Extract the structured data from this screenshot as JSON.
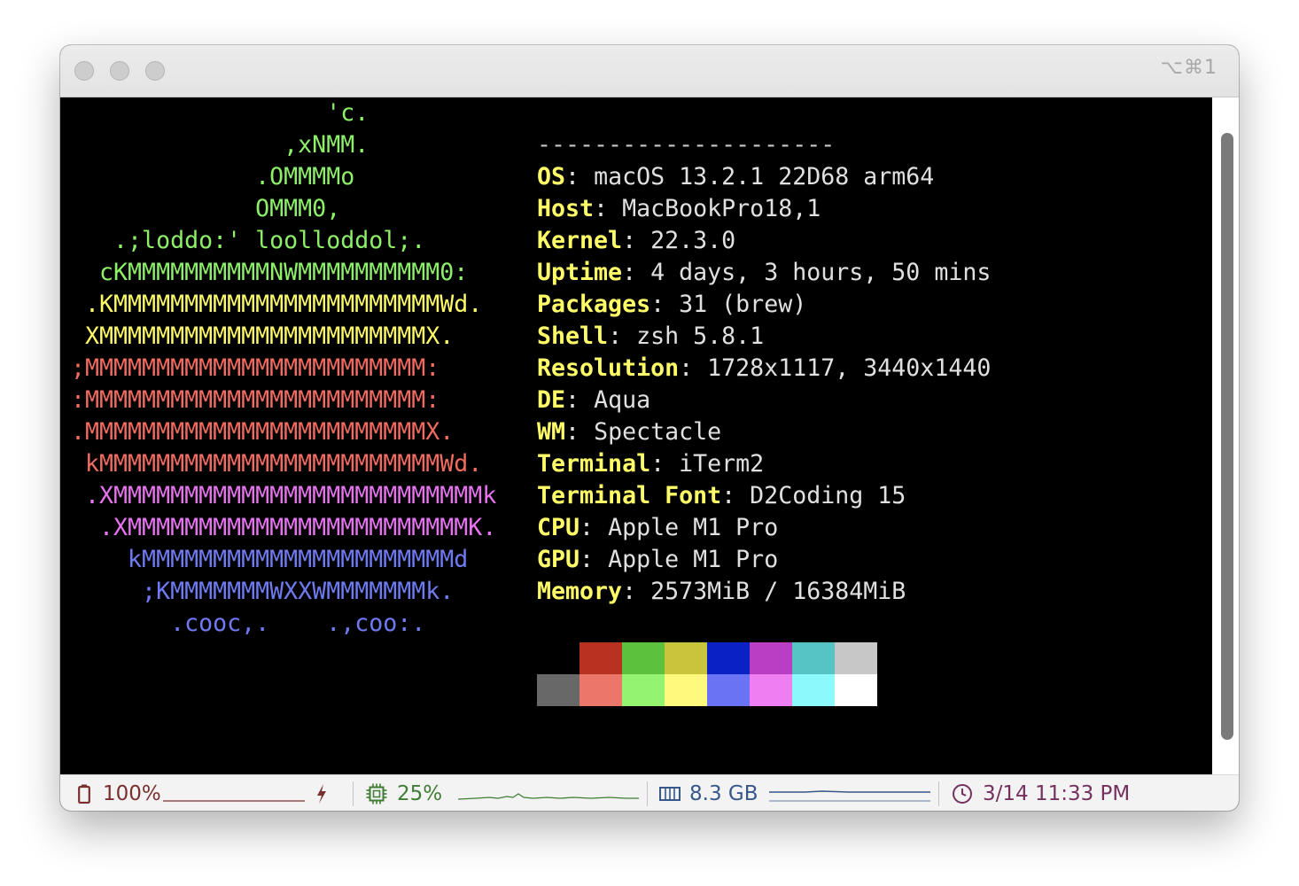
{
  "titlebar": {
    "shortcut": "⌥⌘1"
  },
  "ascii_logo": [
    {
      "text": "                  'c.",
      "color": "#8ef068"
    },
    {
      "text": "               ,xNMM.",
      "color": "#8ef068"
    },
    {
      "text": "             .OMMMMo",
      "color": "#8ef068"
    },
    {
      "text": "             OMMM0,",
      "color": "#8ef068"
    },
    {
      "text": "   .;loddo:' loolloddol;.",
      "color": "#8ef068"
    },
    {
      "text": "  cKMMMMMMMMMMNWMMMMMMMMMM0:",
      "color": "#8ef068"
    },
    {
      "text": " .KMMMMMMMMMMMMMMMMMMMMMMMWd.",
      "color": "#fffc67"
    },
    {
      "text": " XMMMMMMMMMMMMMMMMMMMMMMMX.",
      "color": "#fffc67"
    },
    {
      "text": ";MMMMMMMMMMMMMMMMMMMMMMMM:",
      "color": "#f26b61"
    },
    {
      "text": ":MMMMMMMMMMMMMMMMMMMMMMMM:",
      "color": "#f26b61"
    },
    {
      "text": ".MMMMMMMMMMMMMMMMMMMMMMMMX.",
      "color": "#f26b61"
    },
    {
      "text": " kMMMMMMMMMMMMMMMMMMMMMMMMWd.",
      "color": "#f26b61"
    },
    {
      "text": " .XMMMMMMMMMMMMMMMMMMMMMMMMMMk",
      "color": "#e873f0"
    },
    {
      "text": "  .XMMMMMMMMMMMMMMMMMMMMMMMMK.",
      "color": "#e873f0"
    },
    {
      "text": "    kMMMMMMMMMMMMMMMMMMMMMMd",
      "color": "#6f7bf2"
    },
    {
      "text": "     ;KMMMMMMMWXXWMMMMMMMk.",
      "color": "#6f7bf2"
    },
    {
      "text": "       .cooc,.    .,coo:.",
      "color": "#6f7bf2"
    }
  ],
  "info": {
    "separator": "---------------------",
    "lines": [
      {
        "key": "OS",
        "value": "macOS 13.2.1 22D68 arm64"
      },
      {
        "key": "Host",
        "value": "MacBookPro18,1"
      },
      {
        "key": "Kernel",
        "value": "22.3.0"
      },
      {
        "key": "Uptime",
        "value": "4 days, 3 hours, 50 mins"
      },
      {
        "key": "Packages",
        "value": "31 (brew)"
      },
      {
        "key": "Shell",
        "value": "zsh 5.8.1"
      },
      {
        "key": "Resolution",
        "value": "1728x1117, 3440x1440"
      },
      {
        "key": "DE",
        "value": "Aqua"
      },
      {
        "key": "WM",
        "value": "Spectacle"
      },
      {
        "key": "Terminal",
        "value": "iTerm2"
      },
      {
        "key": "Terminal Font",
        "value": "D2Coding 15"
      },
      {
        "key": "CPU",
        "value": "Apple M1 Pro"
      },
      {
        "key": "GPU",
        "value": "Apple M1 Pro"
      },
      {
        "key": "Memory",
        "value": "2573MiB / 16384MiB"
      }
    ]
  },
  "palette": {
    "normal": [
      "#000000",
      "#b9321f",
      "#5cc13c",
      "#c8c43b",
      "#0a22c4",
      "#b93ec4",
      "#56c3c5",
      "#c7c7c7"
    ],
    "bright": [
      "#686868",
      "#ec766a",
      "#94f470",
      "#fffa7d",
      "#6a73f4",
      "#ee7ef2",
      "#8cf9fd",
      "#ffffff"
    ]
  },
  "statusbar": {
    "battery": {
      "value": "100%",
      "icon": "battery-icon",
      "charging_icon": "bolt-icon",
      "color": "#7a2f2f"
    },
    "cpu": {
      "value": "25%",
      "icon": "cpu-icon",
      "color": "#3f7d34"
    },
    "memory": {
      "value": "8.3 GB",
      "icon": "memory-icon",
      "color": "#37588a"
    },
    "clock": {
      "value": "3/14 11:33 PM",
      "icon": "clock-icon",
      "color": "#74315f"
    }
  }
}
